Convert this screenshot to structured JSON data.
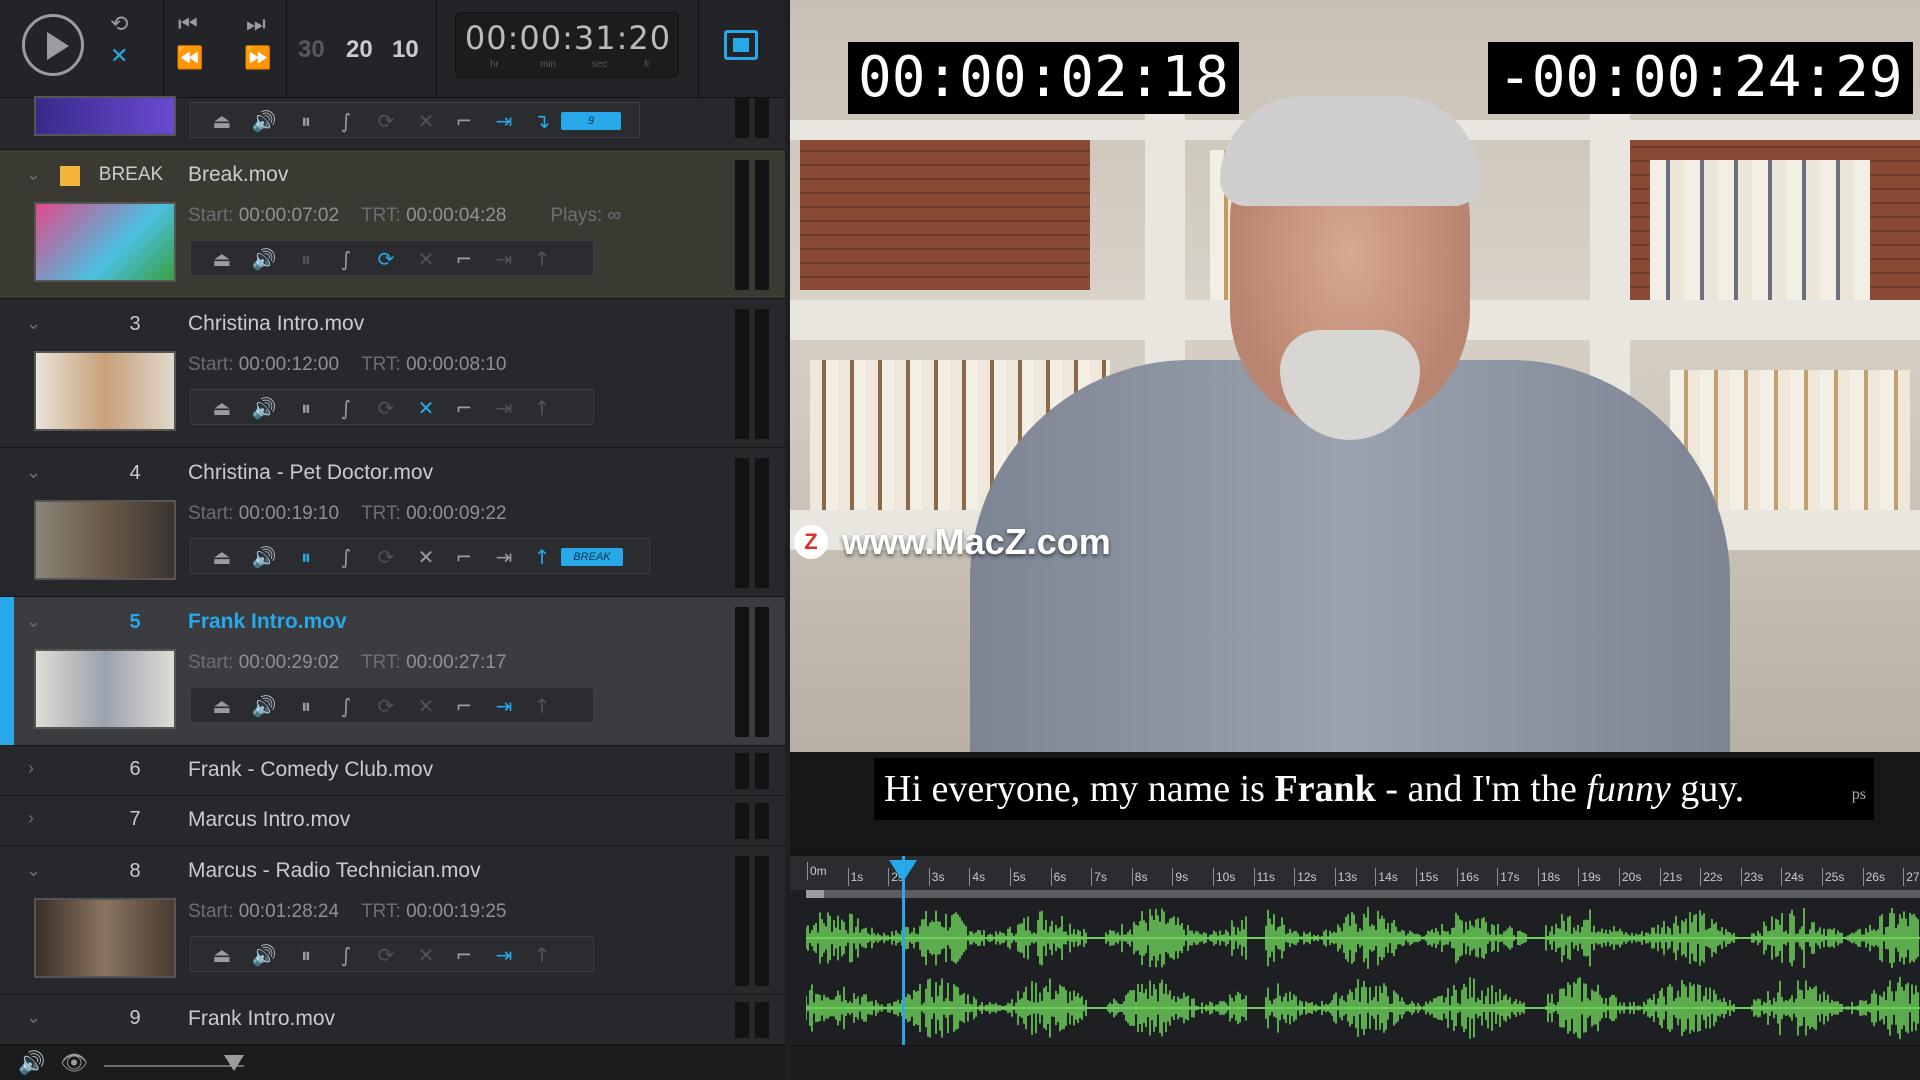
{
  "transport": {
    "countdowns": [
      {
        "label": "",
        "value": "30",
        "dim": true
      },
      {
        "label": "",
        "value": "20",
        "dim": false
      },
      {
        "label": "",
        "value": "10",
        "dim": false
      }
    ],
    "timecode": "00:00:31:20",
    "timecode_units": [
      "hr",
      "min",
      "sec",
      "fr"
    ]
  },
  "cues": [
    {
      "id": "break",
      "number": "BREAK",
      "name": "Break.mov",
      "start": "00:00:07:02",
      "trt": "00:00:04:28",
      "plays": "Plays: ∞",
      "type": "break"
    },
    {
      "id": "3",
      "number": "3",
      "name": "Christina Intro.mov",
      "start": "00:00:12:00",
      "trt": "00:00:08:10"
    },
    {
      "id": "4",
      "number": "4",
      "name": "Christina - Pet Doctor.mov",
      "start": "00:00:19:10",
      "trt": "00:00:09:22",
      "tag": "BREAK"
    },
    {
      "id": "5",
      "number": "5",
      "name": "Frank Intro.mov",
      "start": "00:00:29:02",
      "trt": "00:00:27:17",
      "selected": true
    },
    {
      "id": "6",
      "number": "6",
      "name": "Frank - Comedy Club.mov"
    },
    {
      "id": "7",
      "number": "7",
      "name": "Marcus Intro.mov"
    },
    {
      "id": "8",
      "number": "8",
      "name": "Marcus - Radio Technician.mov",
      "start": "00:01:28:24",
      "trt": "00:00:19:25"
    },
    {
      "id": "9",
      "number": "9",
      "name": "Frank Intro.mov"
    }
  ],
  "labels": {
    "start": "Start:",
    "trt": "TRT:",
    "top_tag": "9"
  },
  "viewer": {
    "elapsed": "00:00:02:18",
    "remaining": "-00:00:24:29",
    "watermark": "www.MacZ.com",
    "watermark_logo": "Z",
    "subtitle": {
      "a": "Hi everyone, my name is ",
      "b": "Frank",
      "c": " - and I'm the ",
      "d": "funny",
      "e": " guy.",
      "suffix": "ps"
    }
  },
  "timeline": {
    "ticks": [
      "0m",
      "1s",
      "2s",
      "3s",
      "4s",
      "5s",
      "6s",
      "7s",
      "8s",
      "9s",
      "10s",
      "11s",
      "12s",
      "13s",
      "14s",
      "15s",
      "16s",
      "17s",
      "18s",
      "19s",
      "20s",
      "21s",
      "22s",
      "23s",
      "24s",
      "25s",
      "26s",
      "27"
    ],
    "playhead_seconds": 2.3
  },
  "colors": {
    "accent": "#27a8e8",
    "break": "#f5b43a",
    "wave": "#6ccf5a"
  }
}
